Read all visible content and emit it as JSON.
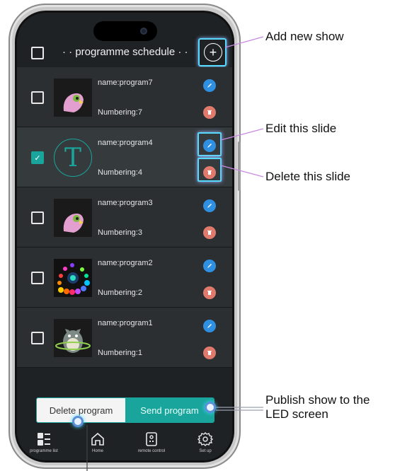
{
  "header": {
    "title": "· · programme schedule · ·",
    "add_icon": "plus-circle-icon"
  },
  "programs": [
    {
      "name": "name:program7",
      "numbering": "Numbering:7",
      "selected": false,
      "thumb": "parrot-image"
    },
    {
      "name": "name:program4",
      "numbering": "Numbering:4",
      "selected": true,
      "thumb_letter": "T"
    },
    {
      "name": "name:program3",
      "numbering": "Numbering:3",
      "selected": false,
      "thumb": "parrot-image"
    },
    {
      "name": "name:program2",
      "numbering": "Numbering:2",
      "selected": false,
      "thumb": "colorful-swirl-image"
    },
    {
      "name": "name:program1",
      "numbering": "Numbering:1",
      "selected": false,
      "thumb": "totoro-image"
    }
  ],
  "actions": {
    "delete_label": "Delete program",
    "send_label": "Send program"
  },
  "tabs": [
    {
      "label": "programme list",
      "icon": "list-icon"
    },
    {
      "label": "Home",
      "icon": "home-icon"
    },
    {
      "label": "remote control",
      "icon": "remote-icon"
    },
    {
      "label": "Set up",
      "icon": "gear-icon"
    }
  ],
  "callouts": {
    "add": "Add new show",
    "edit": "Edit this slide",
    "delete": "Delete this slide",
    "publish_line1": "Publish show to the",
    "publish_line2": "LED screen"
  },
  "colors": {
    "accent": "#1aa59c",
    "edit": "#2f8fe0",
    "delete": "#e07a6c",
    "highlight": "#58d9ff"
  }
}
